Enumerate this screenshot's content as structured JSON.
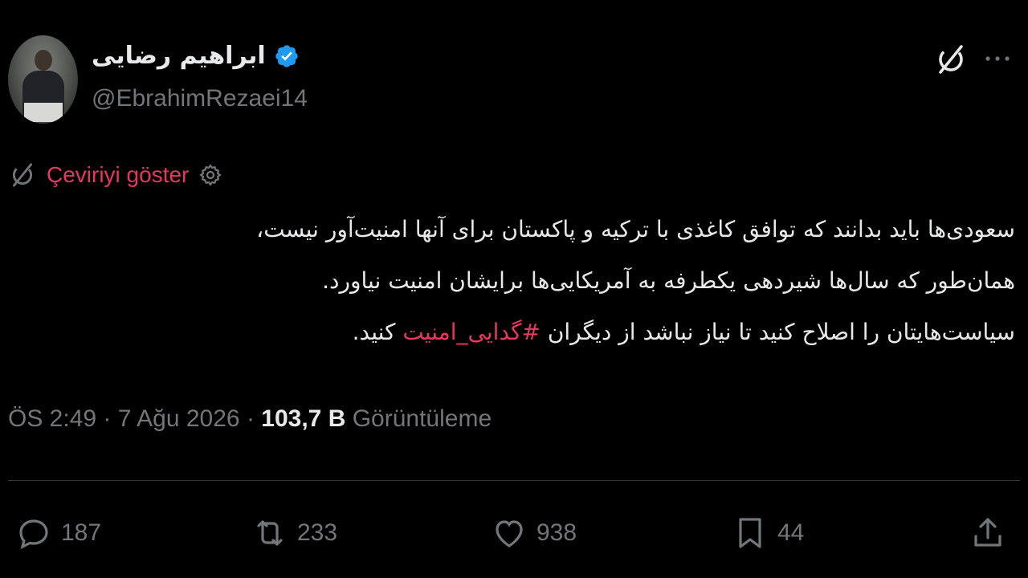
{
  "author": {
    "display_name": "ابراهیم رضایی",
    "handle": "@EbrahimRezaei14",
    "verified": true
  },
  "header_icons": {
    "grok": "grok-icon",
    "more": "more-icon"
  },
  "translate": {
    "label": "Çeviriyi göster"
  },
  "tweet": {
    "line1": "سعودی‌ها باید بدانند که توافق کاغذی با ترکیه و پاکستان برای آنها امنیت‌آور نیست،",
    "line2": "همان‌طور که سال‌ها شیردهی یکطرفه به آمریکایی‌ها برایشان امنیت نیاورد.",
    "line3_before": "سیاست‌هایتان را اصلاح کنید تا نیاز نباشد از دیگران ",
    "hashtag": "#گدایی_امنیت",
    "line3_after": " کنید."
  },
  "meta": {
    "time": "ÖS 2:49",
    "date": "7 Ağu 2026",
    "separator": "·",
    "views_count": "103,7 B",
    "views_label": "Görüntüleme"
  },
  "actions": {
    "replies": "187",
    "reposts": "233",
    "likes": "938",
    "bookmarks": "44"
  },
  "colors": {
    "background": "#000000",
    "text": "#e7e9ea",
    "muted": "#71767b",
    "accent": "#e8365d",
    "verified": "#1d9bf0"
  }
}
